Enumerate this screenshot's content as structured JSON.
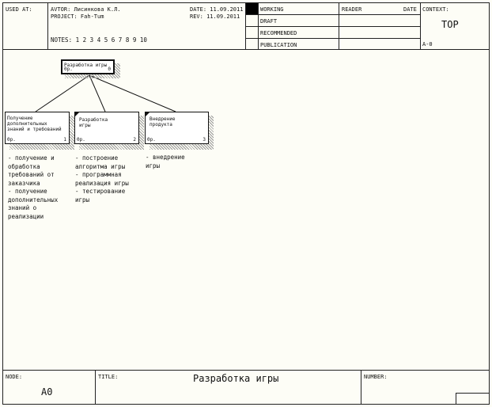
{
  "header": {
    "used_at_label": "USED AT:",
    "author_line": "AVTOR: Лисинкова К.Л.",
    "project_line": "PROJECT: Fah-Tum",
    "date_line": "DATE:  11.09.2011",
    "rev_line": "REV:  11.09.2011",
    "notes_line": "NOTES:  1   2   3   4   5   6   7   8   9   10",
    "statuses": [
      "WORKING",
      "DRAFT",
      "RECOMMENDED",
      "PUBLICATION"
    ],
    "reader_label": "READER",
    "date_label": "DATE",
    "context_label": "CONTEXT:",
    "context_value": "TOP",
    "context_node": "A-0"
  },
  "diagram": {
    "parent": {
      "title": "Разработка игры",
      "cost": "0р.",
      "number": "0"
    },
    "children": [
      {
        "title": "Получение\nдополнительных\nзнаний и требований",
        "cost": "0р.",
        "number": "1",
        "description": "- получение и\nобработка\nтребований от\nзаказчика\n- получение\nдополнительных\nзнаний о\nреализации"
      },
      {
        "title": "Разработка\nигры",
        "cost": "0р.",
        "number": "2",
        "description": "- построение\nалгоритма игры\n- программная\nреализация игры\n- тестирование\nигры"
      },
      {
        "title": "Внедрение\nпродукта",
        "cost": "0р.",
        "number": "3",
        "description": "- внедрение\nигры"
      }
    ]
  },
  "footer": {
    "node_label": "NODE:",
    "node_value": "A0",
    "title_label": "TITLE:",
    "title_value": "Разработка игры",
    "number_label": "NUMBER:"
  }
}
